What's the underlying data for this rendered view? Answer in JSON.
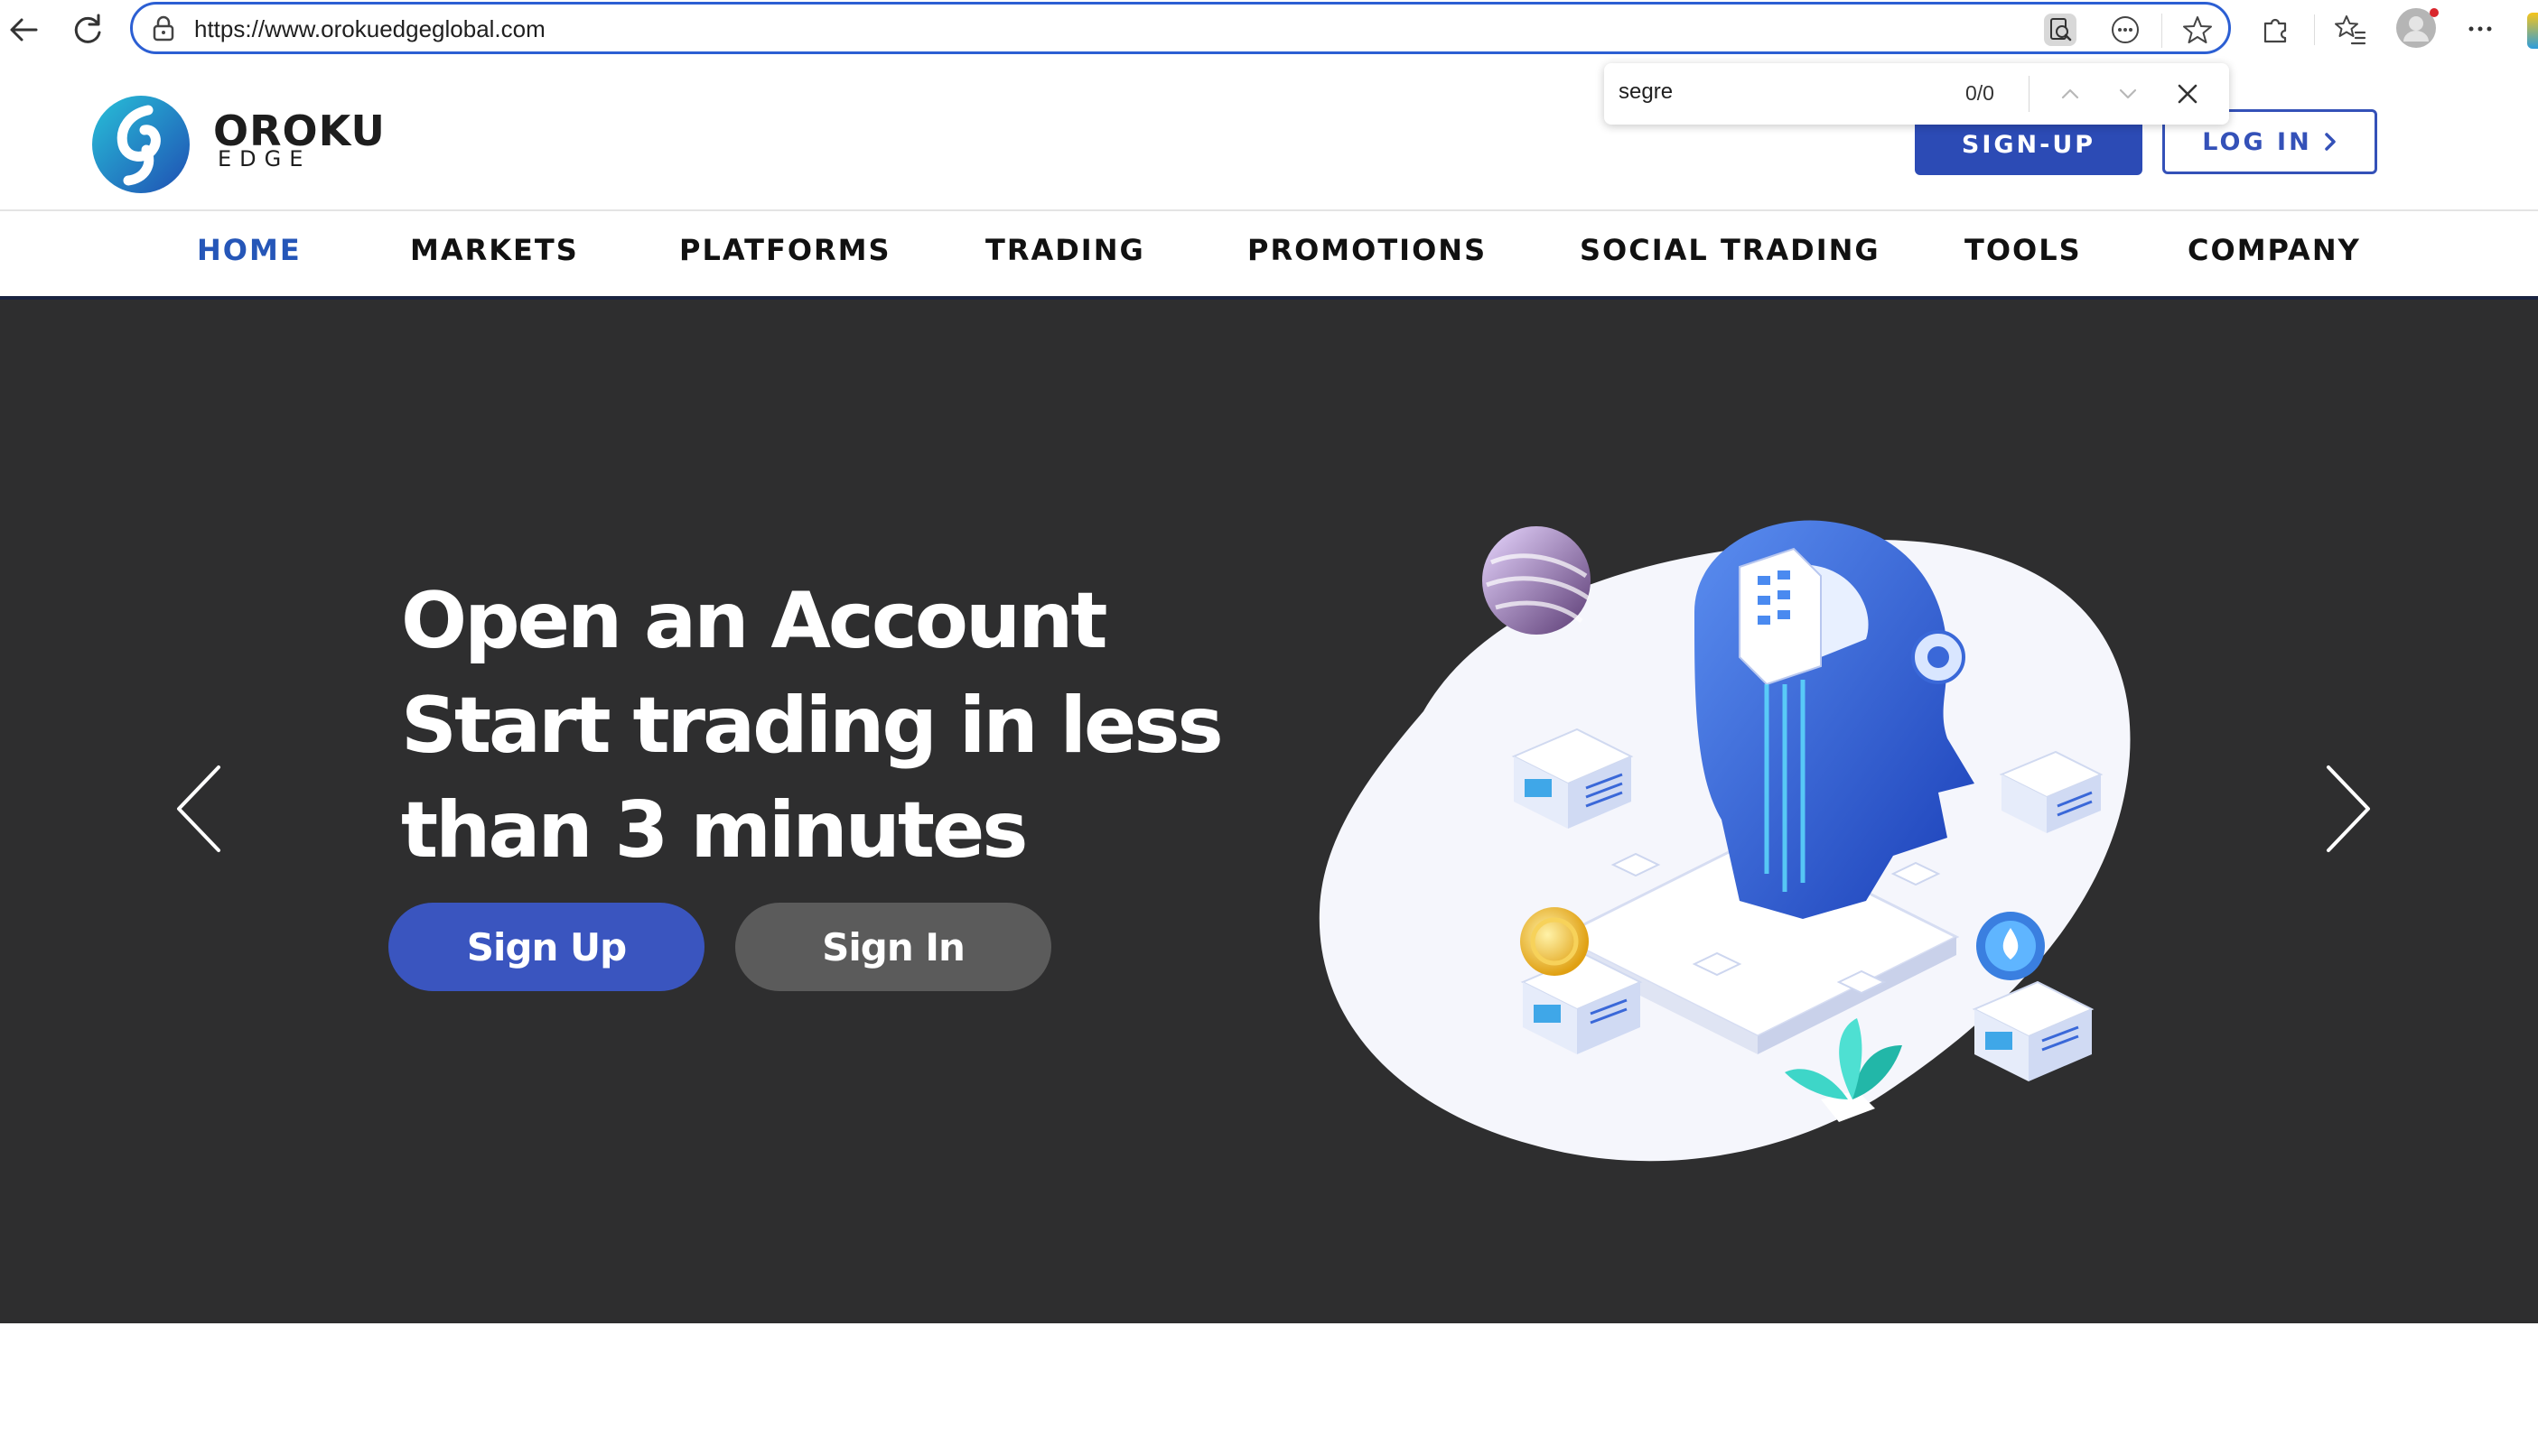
{
  "browser": {
    "url": "https://www.orokuedgeglobal.com"
  },
  "find_bar": {
    "query": "segre",
    "count": "0/0"
  },
  "site": {
    "logo_line1": "OROKU",
    "logo_line2": "EDGE",
    "signup_label": "SIGN-UP",
    "login_label": "LOG IN"
  },
  "nav": {
    "items": [
      {
        "label": "HOME",
        "active": true
      },
      {
        "label": "MARKETS"
      },
      {
        "label": "PLATFORMS"
      },
      {
        "label": "TRADING"
      },
      {
        "label": "PROMOTIONS"
      },
      {
        "label": "SOCIAL TRADING"
      },
      {
        "label": "TOOLS"
      },
      {
        "label": "COMPANY"
      }
    ]
  },
  "hero": {
    "title_lines": [
      "Open an Account",
      "Start trading in less",
      "than 3 minutes"
    ],
    "signup_label": "Sign Up",
    "signin_label": "Sign In"
  },
  "colors": {
    "brand_blue": "#2c4bb5",
    "hero_bg": "#2e2e2f",
    "nav_active": "#2556b8"
  }
}
